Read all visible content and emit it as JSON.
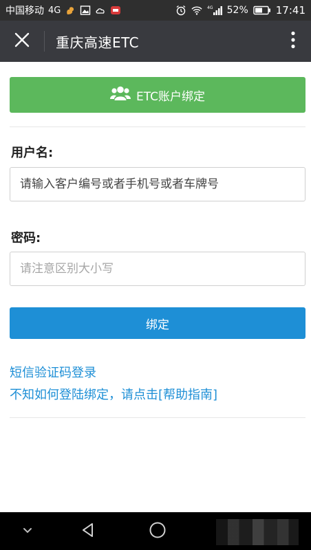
{
  "status_bar": {
    "carrier": "中国移动",
    "network": "4G",
    "signal_network": "4G",
    "battery_percent": "52%",
    "time": "17:41"
  },
  "header": {
    "title": "重庆高速ETC"
  },
  "banner": {
    "label": "ETC账户绑定"
  },
  "form": {
    "username_label": "用户名:",
    "username_placeholder": "请输入客户编号或者手机号或者车牌号",
    "password_label": "密码:",
    "password_placeholder": "请注意区别大小写",
    "submit_label": "绑定"
  },
  "links": {
    "sms_login": "短信验证码登录",
    "help": "不知如何登陆绑定，请点击[帮助指南]"
  },
  "colors": {
    "header_bg": "#393a3f",
    "banner_green": "#5cb85c",
    "primary_blue": "#1e8fd6"
  }
}
